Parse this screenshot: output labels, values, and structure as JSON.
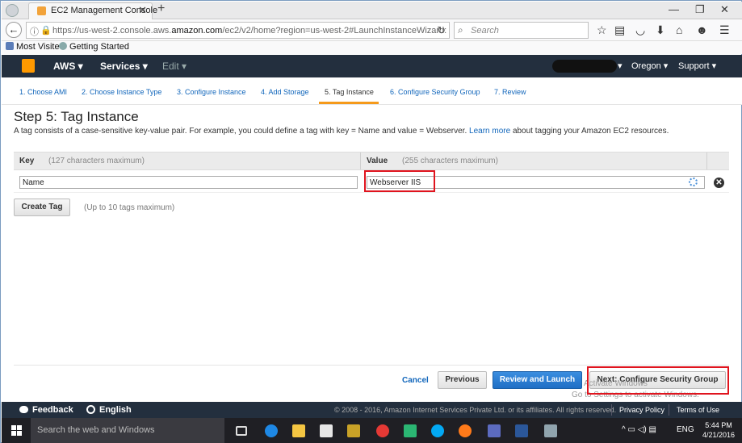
{
  "browser": {
    "tab_title": "EC2 Management Console",
    "url_prefix": "https://us-west-2.console.aws.",
    "url_domain": "amazon.com",
    "url_suffix": "/ec2/v2/home?region=us-west-2#LaunchInstanceWizard:",
    "search_placeholder": "Search",
    "bookmarks": [
      "Most Visited",
      "Getting Started"
    ]
  },
  "aws_nav": {
    "brand": "AWS",
    "services": "Services",
    "edit": "Edit",
    "region": "Oregon",
    "support": "Support"
  },
  "wizard": {
    "steps": [
      "1. Choose AMI",
      "2. Choose Instance Type",
      "3. Configure Instance",
      "4. Add Storage",
      "5. Tag Instance",
      "6. Configure Security Group",
      "7. Review"
    ],
    "active_step": 5,
    "title": "Step 5: Tag Instance",
    "description_before": "A tag consists of a case-sensitive key-value pair. For example, you could define a tag with key = Name and value = Webserver.",
    "learn_more": "Learn more",
    "description_after": "about tagging your Amazon EC2 resources."
  },
  "tags": {
    "key_header": "Key",
    "key_hint": "(127 characters maximum)",
    "value_header": "Value",
    "value_hint": "(255 characters maximum)",
    "rows": [
      {
        "key": "Name",
        "value": "Webserver IIS"
      }
    ],
    "create_button": "Create Tag",
    "create_hint": "(Up to 10 tags maximum)"
  },
  "footer_buttons": {
    "cancel": "Cancel",
    "previous": "Previous",
    "review_launch": "Review and Launch",
    "next": "Next: Configure Security Group"
  },
  "watermark": {
    "line1": "Activate Windows",
    "line2": "Go to Settings to activate Windows."
  },
  "feedback_bar": {
    "feedback": "Feedback",
    "language": "English",
    "copyright": "© 2008 - 2016, Amazon Internet Services Private Ltd. or its affiliates. All rights reserved.",
    "privacy": "Privacy Policy",
    "terms": "Terms of Use"
  },
  "taskbar": {
    "search_placeholder": "Search the web and Windows",
    "language": "ENG",
    "time": "5:44 PM",
    "date": "4/21/2016"
  },
  "colors": {
    "aws_header": "#232f3e",
    "active_step_underline": "#f59a1b",
    "highlight_border": "#e0141e",
    "primary_button": "#1f6fc5",
    "link": "#1166bb"
  }
}
